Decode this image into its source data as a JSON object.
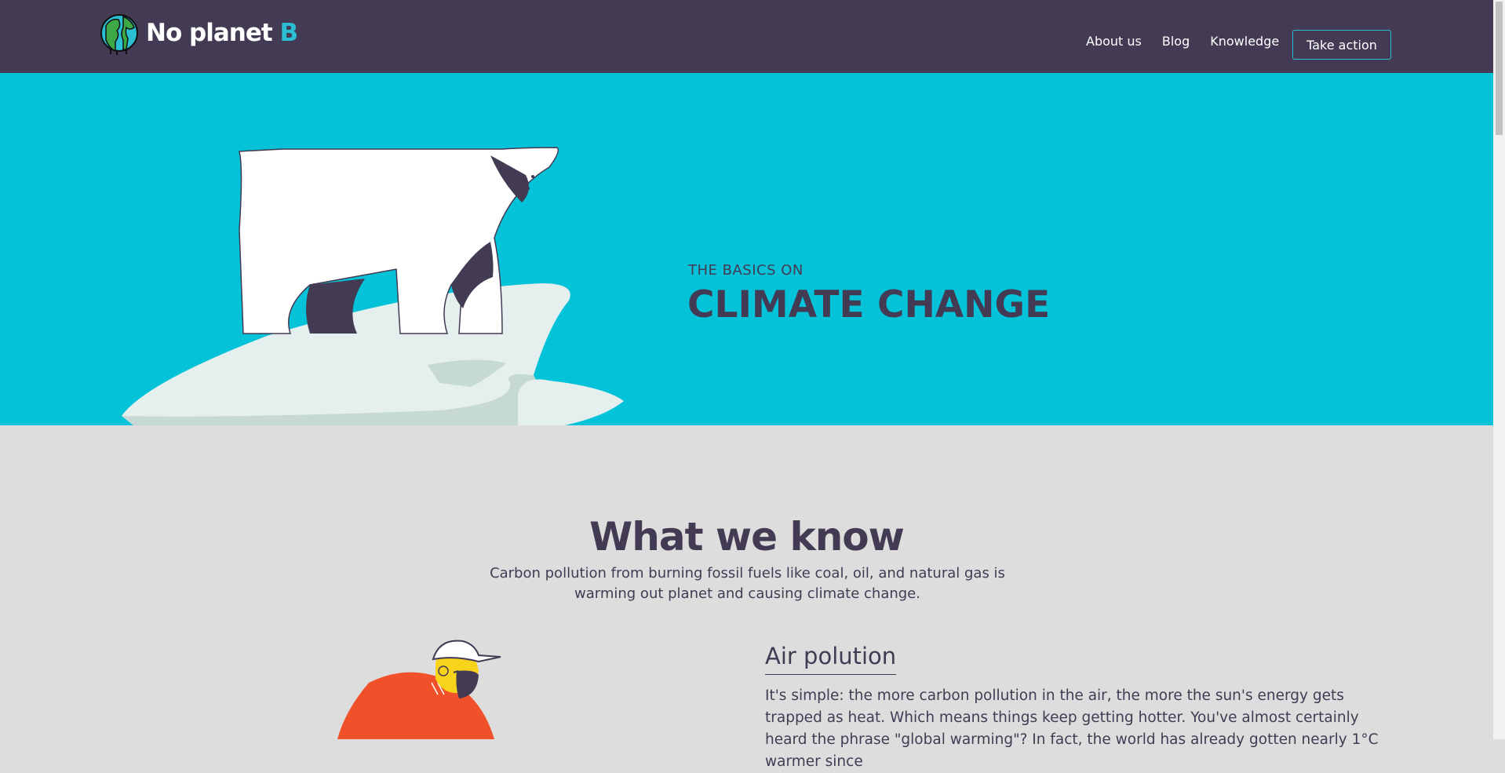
{
  "nav": {
    "logo_main": "No planet ",
    "logo_accent": "B",
    "links": [
      "About us",
      "Blog",
      "Knowledge"
    ],
    "cta": "Take action"
  },
  "hero": {
    "kicker": "THE BASICS ON",
    "title": "CLIMATE CHANGE"
  },
  "section": {
    "title": "What we know",
    "description": "Carbon pollution from burning fossil fuels like coal, oil, and natural gas is warming out planet and causing climate change."
  },
  "topic": {
    "title": "Air polution",
    "text": "It's simple: the more carbon pollution in the air, the more the sun's energy gets trapped as heat. Which means things keep getting hotter. You've almost certainly heard the phrase \"global warming\"? In fact, the world has already gotten nearly 1°C warmer since"
  },
  "colors": {
    "navbar": "#433b53",
    "hero": "#04c2d8",
    "accent": "#2bbfd4",
    "page": "#dddddd"
  },
  "icons": [
    "globe-logo-icon",
    "polar-bear-illustration",
    "person-illustration"
  ]
}
